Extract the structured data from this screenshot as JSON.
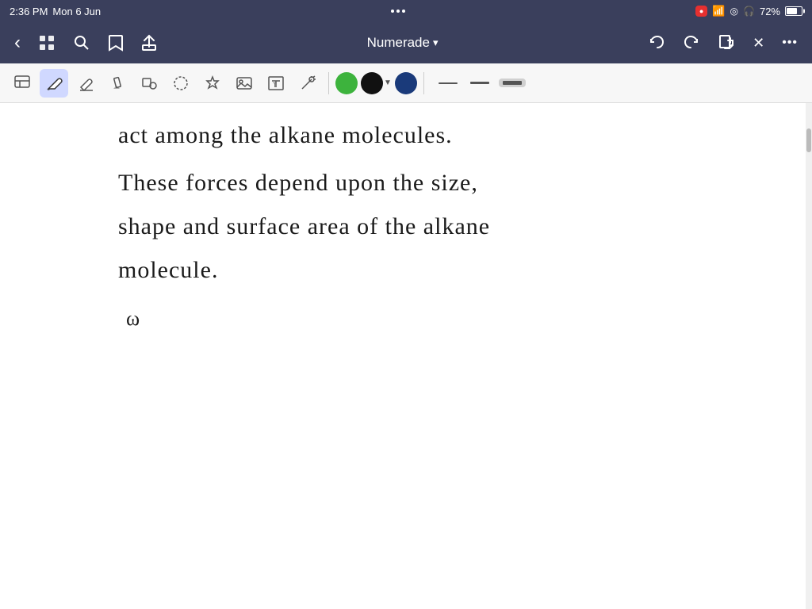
{
  "status_bar": {
    "time": "2:36 PM",
    "date": "Mon 6 Jun",
    "battery_percent": "72%",
    "wifi": true,
    "recording": true
  },
  "nav_bar": {
    "title": "Numerade",
    "chevron": "▾",
    "back_label": "‹",
    "grid_label": "⊞",
    "search_label": "⌕",
    "bookmark_label": "🔖",
    "share_label": "↑",
    "undo_label": "↩",
    "redo_label": "↪",
    "add_label": "+",
    "close_label": "✕",
    "more_label": "•••"
  },
  "toolbar": {
    "select_icon": "⊡",
    "pen_icon": "✏",
    "eraser_icon": "◻",
    "highlight_icon": "✏",
    "shapes_icon": "◇",
    "lasso_icon": "◯",
    "star_icon": "☆",
    "image_icon": "🖼",
    "text_icon": "T",
    "laser_icon": "✦",
    "color_green": "#3db33d",
    "color_black": "#111111",
    "color_blue": "#1a3a7a",
    "size_thin_label": "—",
    "size_mid_label": "—",
    "size_thick_selected": true
  },
  "note": {
    "line1": "act among the alkane molecules.",
    "line2": "These forces depend upon the size,",
    "line3": "shape and surface area of the alkane",
    "line4": "molecule.",
    "line5": "ω"
  }
}
